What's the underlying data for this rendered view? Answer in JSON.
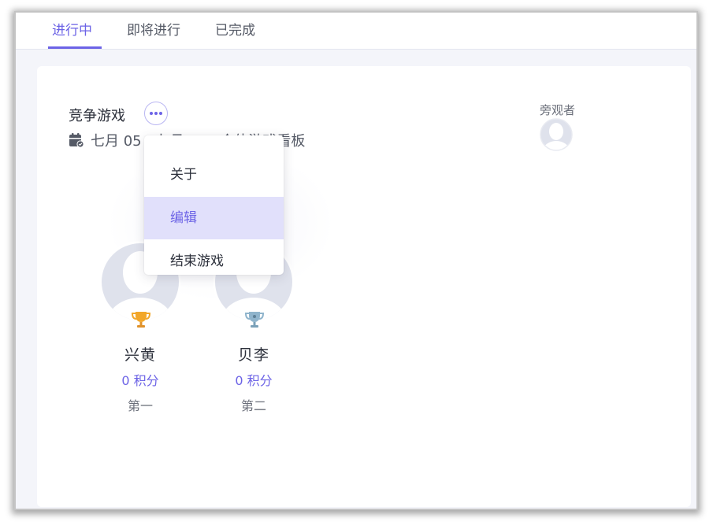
{
  "tabs": [
    {
      "label": "进行中",
      "active": true
    },
    {
      "label": "即将进行",
      "active": false
    },
    {
      "label": "已完成",
      "active": false
    }
  ],
  "game": {
    "title": "竞争游戏",
    "date_text": "七月 05 - 七月 12 · 个体游戏看板",
    "calendar_icon": "calendar-icon",
    "more_icon": "ellipsis-icon"
  },
  "spectators": {
    "label": "旁观者",
    "avatar_icon": "user-avatar-icon"
  },
  "players": [
    {
      "name": "兴黄",
      "points": "0 积分",
      "rank": "第一",
      "trophy_color": "#f2a72a",
      "trophy_icon": "gold-trophy-icon"
    },
    {
      "name": "贝李",
      "points": "0 积分",
      "rank": "第二",
      "trophy_color": "#8fb4cc",
      "trophy_icon": "silver-trophy-icon"
    }
  ],
  "menu": {
    "items": [
      {
        "label": "关于"
      },
      {
        "label": "编辑",
        "highlighted": true
      },
      {
        "label": "结束游戏"
      }
    ]
  },
  "colors": {
    "accent": "#6c63e6",
    "menu_highlight": "#e1e0fb",
    "page_bg": "#f4f5fa",
    "avatar_bg": "#dfe2ec"
  }
}
